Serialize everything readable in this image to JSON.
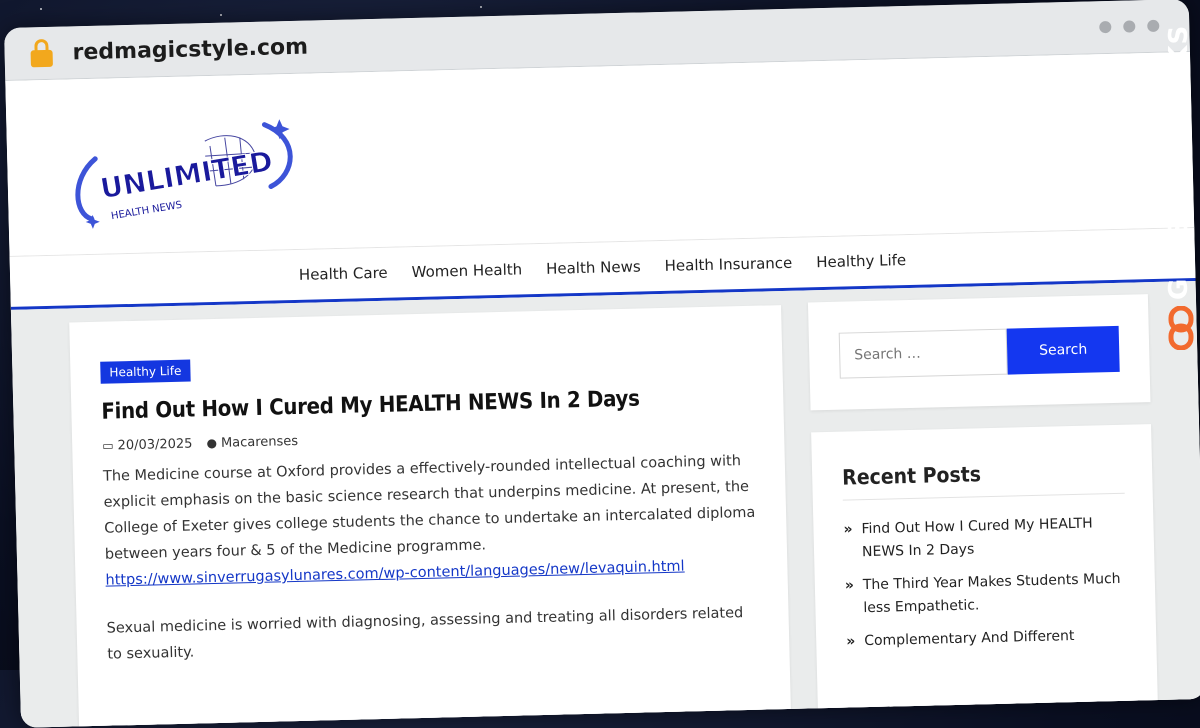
{
  "browser": {
    "url": "redmagicstyle.com"
  },
  "logo": {
    "main_text": "UNLIMITED",
    "sub_text": "HEALTH NEWS"
  },
  "nav": {
    "items": [
      "Health Care",
      "Women Health",
      "Health News",
      "Health Insurance",
      "Healthy Life"
    ]
  },
  "article": {
    "category": "Healthy Life",
    "title": "Find Out How I Cured My HEALTH NEWS In 2 Days",
    "date": "20/03/2025",
    "author": "Macarenses",
    "paragraph1": "The Medicine course at Oxford provides a effectively-rounded intellectual coaching with explicit emphasis on the basic science research that underpins medicine. At present, the College of Exeter gives college students the chance to undertake an intercalated diploma between years four & 5 of the Medicine programme.",
    "link": "https://www.sinverrugasylunares.com/wp-content/languages/new/levaquin.html",
    "paragraph2": "Sexual medicine is worried with diagnosing, assessing and treating all disorders related to sexuality."
  },
  "search": {
    "placeholder": "Search …",
    "button_label": "Search"
  },
  "recent_posts": {
    "title": "Recent Posts",
    "items": [
      "Find Out How I Cured My HEALTH NEWS In 2 Days",
      "The Third Year Makes Students Much less Empathetic.",
      "Complementary And Different"
    ]
  },
  "watermark": {
    "text": "GUESTPOSTLINKS"
  },
  "colors": {
    "accent": "#1437e0",
    "lock": "#f2a81d",
    "brand_orange": "#f26a2e"
  }
}
